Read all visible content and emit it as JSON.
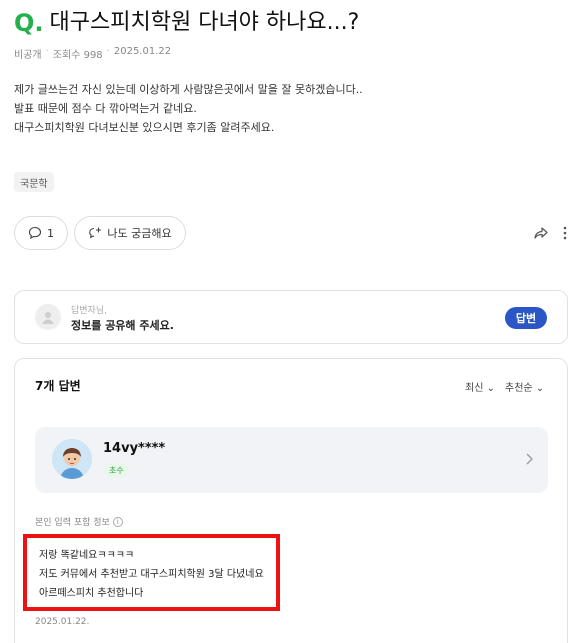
{
  "question": {
    "mark": "Q.",
    "title": "대구스피치학원 다녀야 하나요...?",
    "meta": {
      "visibility": "비공개",
      "views": "조회수 998",
      "date": "2025.01.22"
    },
    "body": [
      "제가 글쓰는건 자신 있는데 이상하게 사람많은곳에서 말을 잘 못하겠습니다..",
      "발표 때문에 점수 다 깎아먹는거 같네요.",
      "대구스피치학원 다녀보신분 있으시면 후기좀 알려주세요."
    ],
    "tag": "국문학",
    "comment_count": "1",
    "curious_label": "나도 궁금해요"
  },
  "answer_prompt": {
    "sub": "답변자님,",
    "main": "정보를 공유해 주세요.",
    "button": "답변"
  },
  "answers": {
    "count_label": "7개 답변",
    "sort_latest": "최신",
    "sort_recommended": "추천순",
    "first": {
      "user_name": "14vy****",
      "badge": "초수",
      "info_label": "본인 입력 포함 정보",
      "info_icon": "i",
      "lines": [
        "저랑 똑같네요ㅋㅋㅋㅋ",
        "저도 커뮤에서 추천받고 대구스피치학원 3달 다녔네요",
        "아르떼스피치 추천합니다"
      ],
      "date": "2025.01.22."
    }
  },
  "colors": {
    "q_mark": "#22b14c",
    "answer_button": "#2a56c6",
    "highlight_box": "#ee1111"
  }
}
